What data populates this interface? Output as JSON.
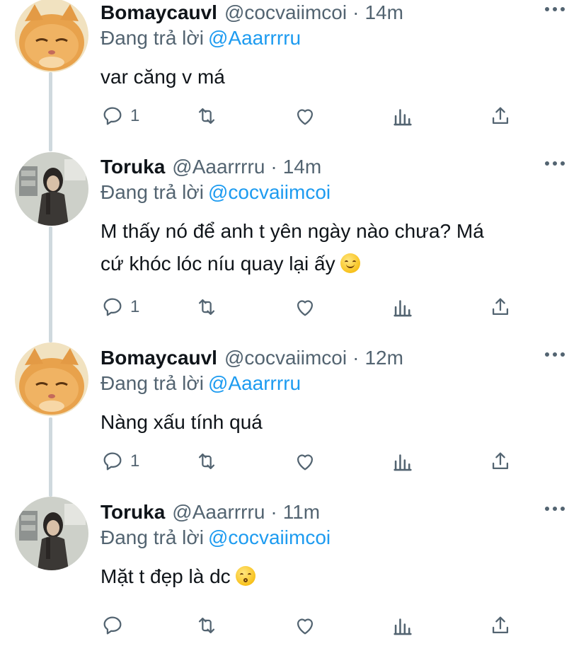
{
  "tweets": [
    {
      "author": "Bomaycauvl",
      "handle": "@cocvaiimcoi",
      "separator": "·",
      "time": "14m",
      "reply_prefix": "Đang trả lời",
      "reply_to": "@Aaarrrru",
      "text": "var căng v má",
      "reply_count": "1",
      "avatar": "cat-avatar"
    },
    {
      "author": "Toruka",
      "handle": "@Aaarrrru",
      "separator": "·",
      "time": "14m",
      "reply_prefix": "Đang trả lời",
      "reply_to": "@cocvaiimcoi",
      "text_line1": "M thấy nó để anh t yên ngày nào chưa? Má",
      "text_line2": "cứ khóc lóc níu quay lại ấy",
      "emoji": "smiling-face-emoji",
      "reply_count": "1",
      "avatar": "girl-avatar"
    },
    {
      "author": "Bomaycauvl",
      "handle": "@cocvaiimcoi",
      "separator": "·",
      "time": "12m",
      "reply_prefix": "Đang trả lời",
      "reply_to": "@Aaarrrru",
      "text": "Nàng xấu tính quá",
      "reply_count": "1",
      "avatar": "cat-avatar"
    },
    {
      "author": "Toruka",
      "handle": "@Aaarrrru",
      "separator": "·",
      "time": "11m",
      "reply_prefix": "Đang trả lời",
      "reply_to": "@cocvaiimcoi",
      "text": "Mặt t đẹp là dc",
      "emoji": "kissing-face-emoji",
      "reply_count": "",
      "avatar": "girl-avatar"
    }
  ],
  "colors": {
    "text": "#0f1419",
    "secondary": "#536471",
    "link": "#1d9bf0",
    "thread_line": "#cfd9de"
  },
  "icons": [
    "reply-icon",
    "retweet-icon",
    "like-icon",
    "analytics-icon",
    "share-icon",
    "more-icon"
  ]
}
